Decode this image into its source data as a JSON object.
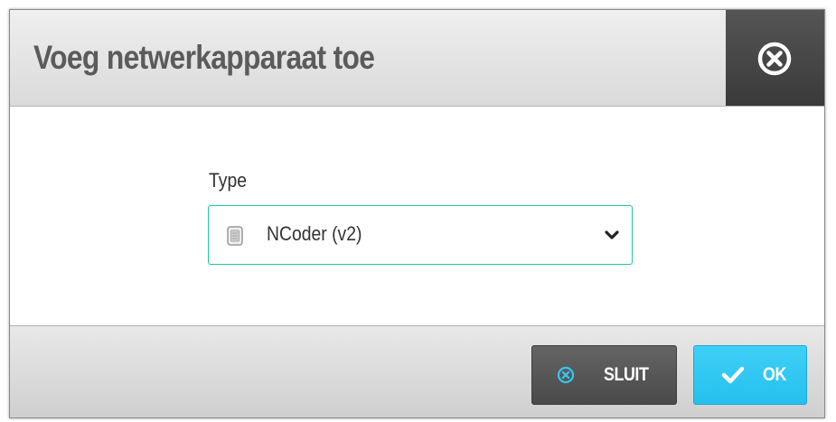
{
  "dialog": {
    "title": "Voeg netwerkapparaat toe",
    "close_icon": "circle-x-icon"
  },
  "form": {
    "type_label": "Type",
    "type_select": {
      "icon": "device-icon",
      "value": "NCoder (v2)",
      "dropdown_icon": "chevron-down-icon"
    }
  },
  "footer": {
    "close_button": {
      "icon": "circle-x-icon",
      "label": "SLUIT"
    },
    "ok_button": {
      "icon": "checkmark-icon",
      "label": "OK"
    }
  },
  "colors": {
    "accent_teal": "#22c4a3",
    "ok_blue": "#2cc5f2",
    "close_dark": "#555555",
    "title_gray": "#5b5b5b"
  }
}
